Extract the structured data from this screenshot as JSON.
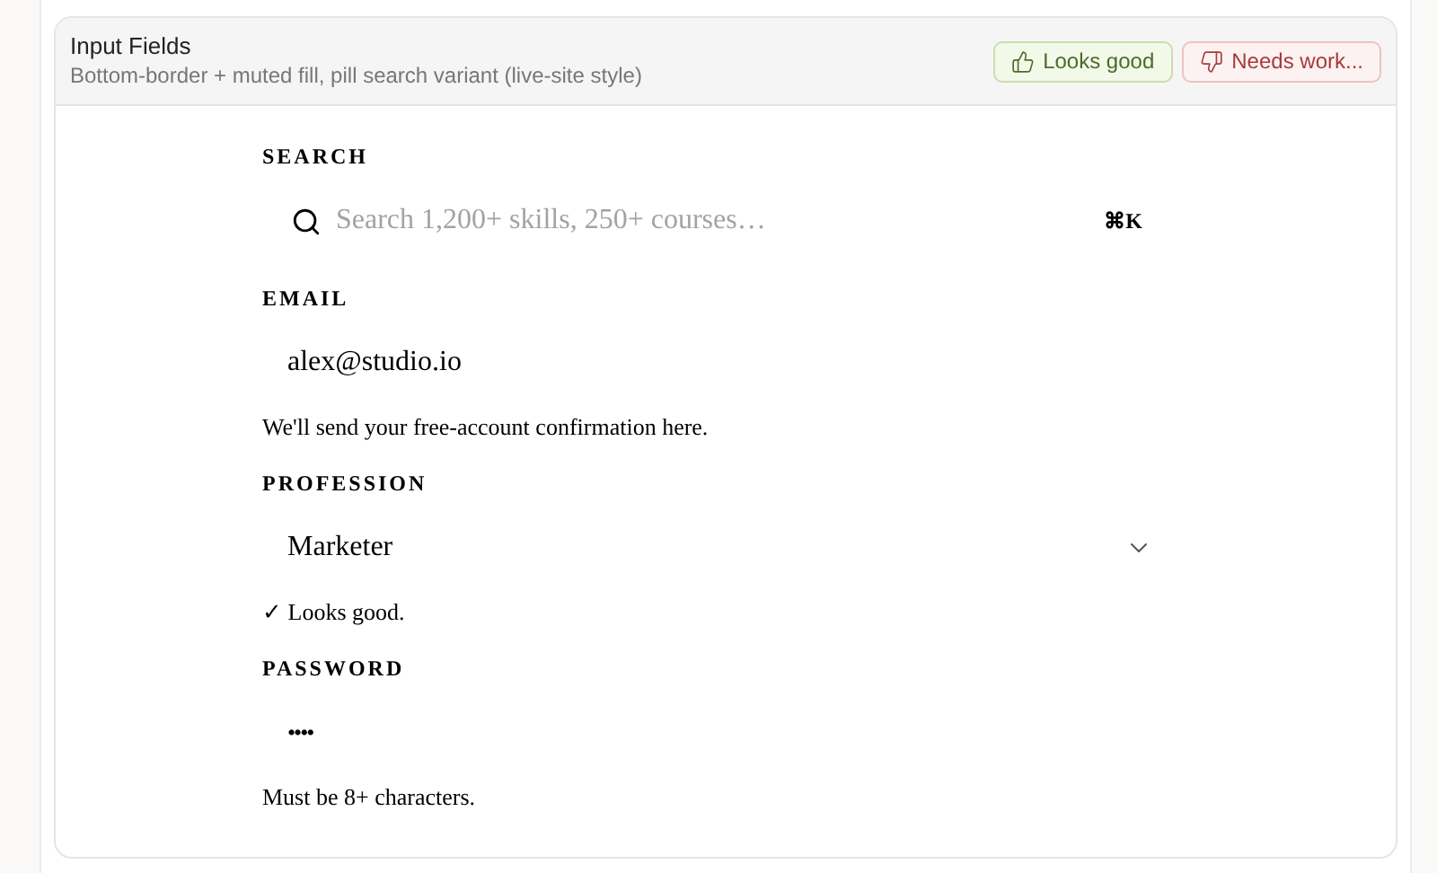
{
  "card": {
    "title": "Input Fields",
    "subtitle": "Bottom-border + muted fill, pill search variant (live-site style)",
    "feedback": [
      {
        "kind": "good",
        "label": "Looks good"
      },
      {
        "kind": "bad",
        "label": "Needs work..."
      }
    ]
  },
  "fields": [
    {
      "kind": "search",
      "label": "SEARCH",
      "placeholder": "Search 1,200+ skills, 250+ courses…",
      "shortcut": "⌘K"
    },
    {
      "kind": "text",
      "label": "EMAIL",
      "value": "alex@studio.io",
      "hint": "We'll send your free-account confirmation here."
    },
    {
      "kind": "select",
      "label": "PROFESSION",
      "value": "Marketer",
      "hint": "✓ Looks good."
    },
    {
      "kind": "password",
      "label": "PASSWORD",
      "value": "••••",
      "hint": "Must be 8+ characters."
    }
  ]
}
